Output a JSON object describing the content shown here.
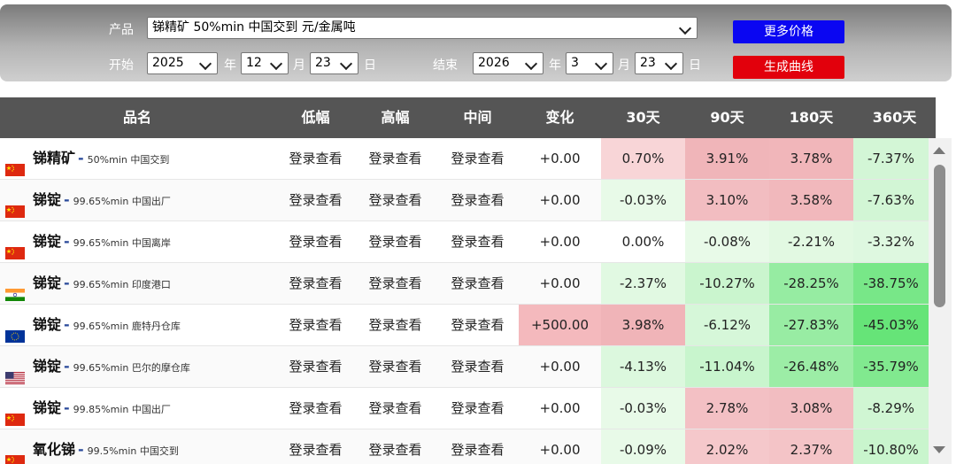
{
  "filter": {
    "product_label": "产品",
    "product_value": "锑精矿 50%min 中国交到 元/金属吨",
    "start_label": "开始",
    "start_year": "2025",
    "start_month": "12",
    "start_day": "23",
    "end_label": "结束",
    "end_year": "2026",
    "end_month": "3",
    "end_day": "23",
    "year_unit": "年",
    "month_unit": "月",
    "day_unit": "日",
    "more_prices_button": "更多价格",
    "generate_curve_button": "生成曲线"
  },
  "table": {
    "headers": [
      "品名",
      "低幅",
      "高幅",
      "中间",
      "变化",
      "30天",
      "90天",
      "180天",
      "360天"
    ],
    "rows": [
      {
        "flag": "cn",
        "name": "锑精矿",
        "spec": "50%min 中国交到",
        "low": "登录查看",
        "high": "登录查看",
        "mid": "登录查看",
        "change": "+0.00",
        "d30": "0.70%",
        "d90": "3.91%",
        "d180": "3.78%",
        "d360": "-7.37%"
      },
      {
        "flag": "cn",
        "name": "锑锭",
        "spec": "99.65%min 中国出厂",
        "low": "登录查看",
        "high": "登录查看",
        "mid": "登录查看",
        "change": "+0.00",
        "d30": "-0.03%",
        "d90": "3.10%",
        "d180": "3.58%",
        "d360": "-7.63%"
      },
      {
        "flag": "cn",
        "name": "锑锭",
        "spec": "99.65%min 中国离岸",
        "low": "登录查看",
        "high": "登录查看",
        "mid": "登录查看",
        "change": "+0.00",
        "d30": "0.00%",
        "d90": "-0.08%",
        "d180": "-2.21%",
        "d360": "-3.32%"
      },
      {
        "flag": "in",
        "name": "锑锭",
        "spec": "99.65%min 印度港口",
        "low": "登录查看",
        "high": "登录查看",
        "mid": "登录查看",
        "change": "+0.00",
        "d30": "-2.37%",
        "d90": "-10.27%",
        "d180": "-28.25%",
        "d360": "-38.75%"
      },
      {
        "flag": "eu",
        "name": "锑锭",
        "spec": "99.65%min 鹿特丹仓库",
        "low": "登录查看",
        "high": "登录查看",
        "mid": "登录查看",
        "change": "+500.00",
        "d30": "3.98%",
        "d90": "-6.12%",
        "d180": "-27.83%",
        "d360": "-45.03%"
      },
      {
        "flag": "us",
        "name": "锑锭",
        "spec": "99.65%min 巴尔的摩仓库",
        "low": "登录查看",
        "high": "登录查看",
        "mid": "登录查看",
        "change": "+0.00",
        "d30": "-4.13%",
        "d90": "-11.04%",
        "d180": "-26.48%",
        "d360": "-35.79%"
      },
      {
        "flag": "cn",
        "name": "锑锭",
        "spec": "99.85%min 中国出厂",
        "low": "登录查看",
        "high": "登录查看",
        "mid": "登录查看",
        "change": "+0.00",
        "d30": "-0.03%",
        "d90": "2.78%",
        "d180": "3.08%",
        "d360": "-8.29%"
      },
      {
        "flag": "cn",
        "name": "氧化锑",
        "spec": "99.5%min 中国交到",
        "low": "登录查看",
        "high": "登录查看",
        "mid": "登录查看",
        "change": "+0.00",
        "d30": "-0.09%",
        "d90": "2.02%",
        "d180": "2.37%",
        "d360": "-10.80%"
      }
    ]
  }
}
